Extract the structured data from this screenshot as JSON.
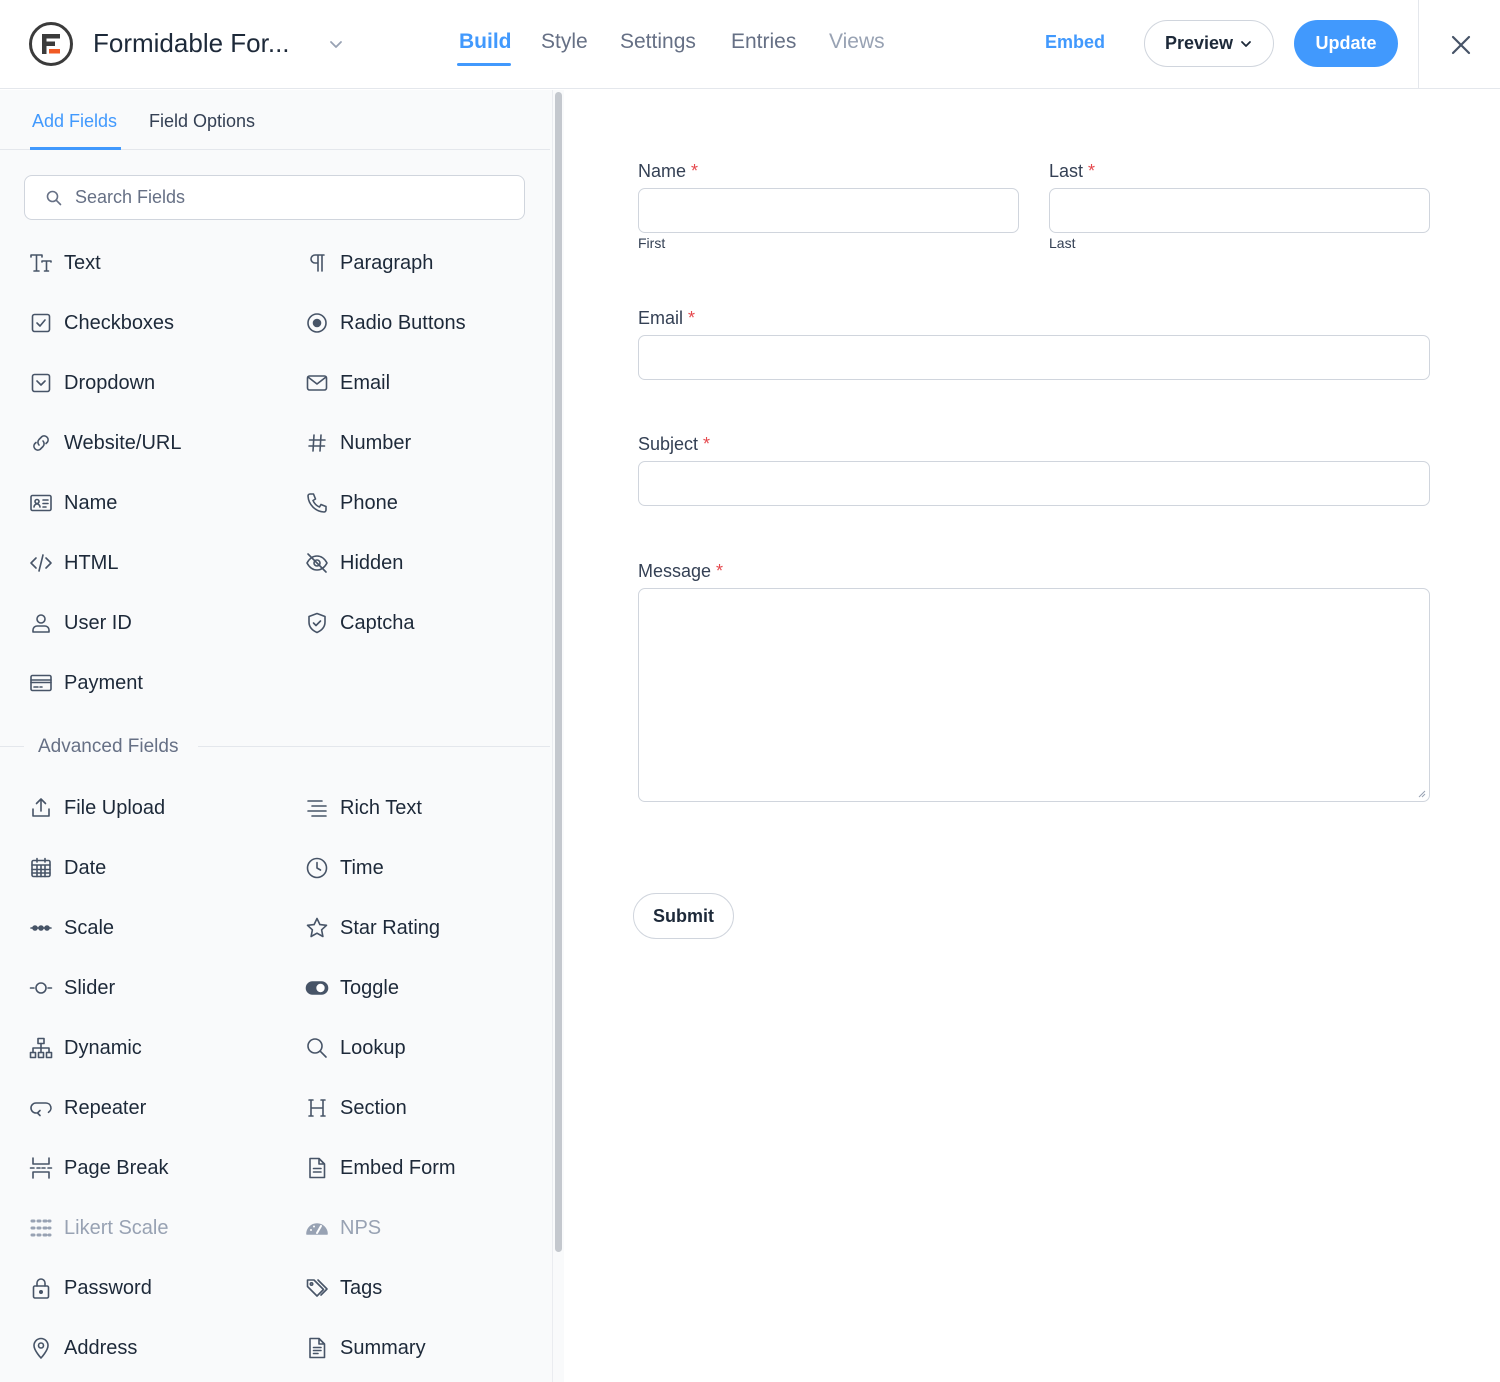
{
  "header": {
    "form_title": "Formidable For...",
    "tabs": [
      {
        "label": "Build",
        "state": "active"
      },
      {
        "label": "Style",
        "state": "normal"
      },
      {
        "label": "Settings",
        "state": "normal"
      },
      {
        "label": "Entries",
        "state": "normal"
      },
      {
        "label": "Views",
        "state": "disabled"
      }
    ],
    "embed_label": "Embed",
    "preview_label": "Preview",
    "update_label": "Update"
  },
  "sidebar": {
    "tabs": [
      {
        "label": "Add Fields",
        "state": "active"
      },
      {
        "label": "Field Options",
        "state": "normal"
      }
    ],
    "search_placeholder": "Search Fields",
    "basic_fields": [
      {
        "label": "Text",
        "icon": "text-icon"
      },
      {
        "label": "Paragraph",
        "icon": "paragraph-icon"
      },
      {
        "label": "Checkboxes",
        "icon": "checkbox-icon"
      },
      {
        "label": "Radio Buttons",
        "icon": "radio-icon"
      },
      {
        "label": "Dropdown",
        "icon": "dropdown-icon"
      },
      {
        "label": "Email",
        "icon": "envelope-icon"
      },
      {
        "label": "Website/URL",
        "icon": "link-icon"
      },
      {
        "label": "Number",
        "icon": "hash-icon"
      },
      {
        "label": "Name",
        "icon": "id-card-icon"
      },
      {
        "label": "Phone",
        "icon": "phone-icon"
      },
      {
        "label": "HTML",
        "icon": "code-icon"
      },
      {
        "label": "Hidden",
        "icon": "eye-off-icon"
      },
      {
        "label": "User ID",
        "icon": "user-icon"
      },
      {
        "label": "Captcha",
        "icon": "shield-icon"
      },
      {
        "label": "Payment",
        "icon": "credit-card-icon"
      }
    ],
    "advanced_title": "Advanced Fields",
    "advanced_fields": [
      {
        "label": "File Upload",
        "icon": "upload-icon"
      },
      {
        "label": "Rich Text",
        "icon": "align-icon"
      },
      {
        "label": "Date",
        "icon": "calendar-icon"
      },
      {
        "label": "Time",
        "icon": "clock-icon"
      },
      {
        "label": "Scale",
        "icon": "scale-dots-icon"
      },
      {
        "label": "Star Rating",
        "icon": "star-icon"
      },
      {
        "label": "Slider",
        "icon": "slider-icon"
      },
      {
        "label": "Toggle",
        "icon": "toggle-icon"
      },
      {
        "label": "Dynamic",
        "icon": "sitemap-icon"
      },
      {
        "label": "Lookup",
        "icon": "magnifier-icon"
      },
      {
        "label": "Repeater",
        "icon": "repeat-icon"
      },
      {
        "label": "Section",
        "icon": "heading-icon"
      },
      {
        "label": "Page Break",
        "icon": "page-break-icon"
      },
      {
        "label": "Embed Form",
        "icon": "document-icon"
      },
      {
        "label": "Likert Scale",
        "icon": "grid-dots-icon",
        "muted": true
      },
      {
        "label": "NPS",
        "icon": "gauge-icon",
        "muted": true
      },
      {
        "label": "Password",
        "icon": "lock-icon"
      },
      {
        "label": "Tags",
        "icon": "tag-icon"
      },
      {
        "label": "Address",
        "icon": "map-pin-icon"
      },
      {
        "label": "Summary",
        "icon": "summary-icon"
      }
    ]
  },
  "form": {
    "name_label": "Name",
    "last_label": "Last",
    "first_sublabel": "First",
    "last_sublabel": "Last",
    "email_label": "Email",
    "subject_label": "Subject",
    "message_label": "Message",
    "required_marker": "*",
    "submit_label": "Submit"
  },
  "colors": {
    "accent": "#4199fd",
    "required": "#e5484d",
    "logo_red": "#f15a24"
  }
}
